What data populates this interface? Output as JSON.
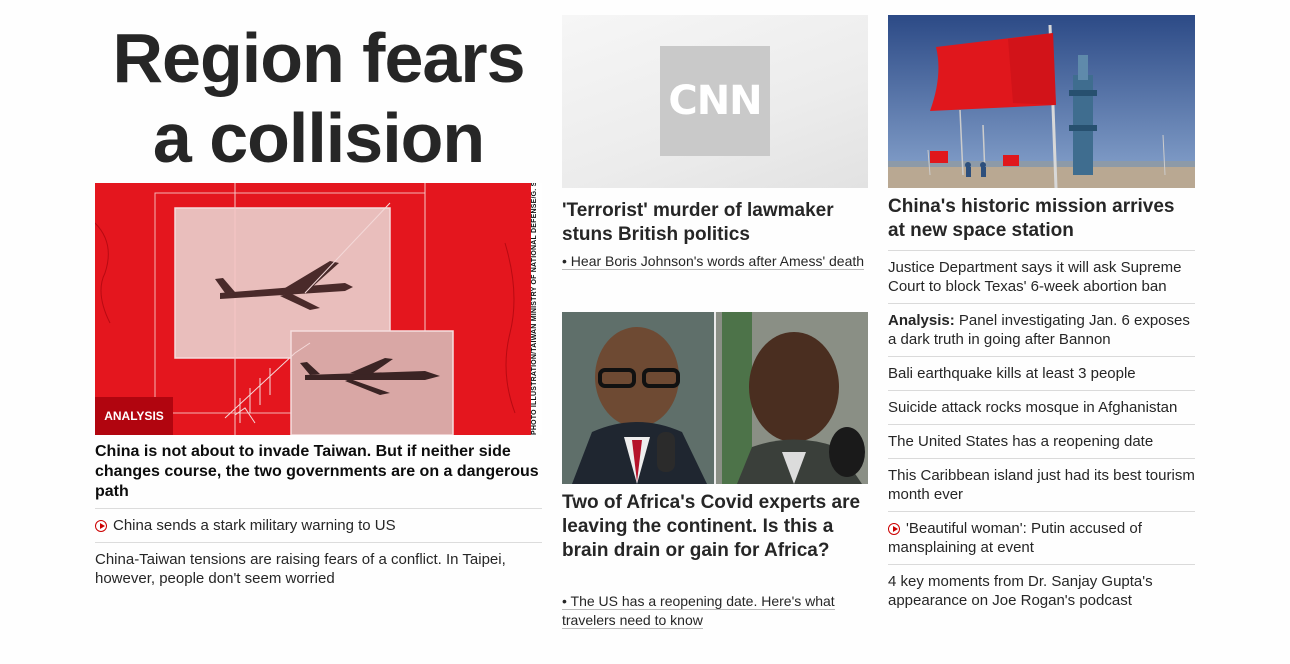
{
  "main": {
    "headline_line1": "Region fears",
    "headline_line2": "a collision",
    "hero_badge": "ANALYSIS",
    "hero_credit": "PHOTO ILLUSTRATION/TAIWAN MINISTRY OF NATIONAL DEFENSE/G. SMITH",
    "hero_title": "China is not about to invade Taiwan. But if neither side changes course, the two governments are on a dangerous path",
    "related_video": "China sends a stark military warning to US",
    "related_text": "China-Taiwan tensions are raising fears of a conflict. In Taipei, however, people don't seem worried"
  },
  "middle": {
    "logo_text": "CNN",
    "story1_title": "'Terrorist' murder of lawmaker stuns British politics",
    "story1_sub": "• Hear Boris Johnson's words after Amess' death",
    "story2_title": "Two of Africa's Covid experts are leaving the continent. Is this a brain drain or gain for Africa?",
    "story2_sub": "• The US has a reopening date. Here's what travelers need to know"
  },
  "right": {
    "lead_title": "China's historic mission arrives at new space station",
    "items": [
      {
        "prefix": "",
        "text": "Justice Department says it will ask Supreme Court to block Texas' 6-week abortion ban",
        "video": false
      },
      {
        "prefix": "Analysis:",
        "text": " Panel investigating Jan. 6 exposes a dark truth in going after Bannon",
        "video": false
      },
      {
        "prefix": "",
        "text": "Bali earthquake kills at least 3 people",
        "video": false
      },
      {
        "prefix": "",
        "text": "Suicide attack rocks mosque in Afghanistan",
        "video": false
      },
      {
        "prefix": "",
        "text": "The United States has a reopening date",
        "video": false
      },
      {
        "prefix": "",
        "text": "This Caribbean island just had its best tourism month ever",
        "video": false
      },
      {
        "prefix": "",
        "text": "'Beautiful woman': Putin accused of mansplaining at event",
        "video": true
      },
      {
        "prefix": "",
        "text": "4 key moments from Dr. Sanjay Gupta's appearance on Joe Rogan's podcast",
        "video": false
      }
    ]
  },
  "colors": {
    "accent": "#cc0000",
    "badge": "#b1050f",
    "hero_red": "#e4161e",
    "text": "#262626"
  }
}
